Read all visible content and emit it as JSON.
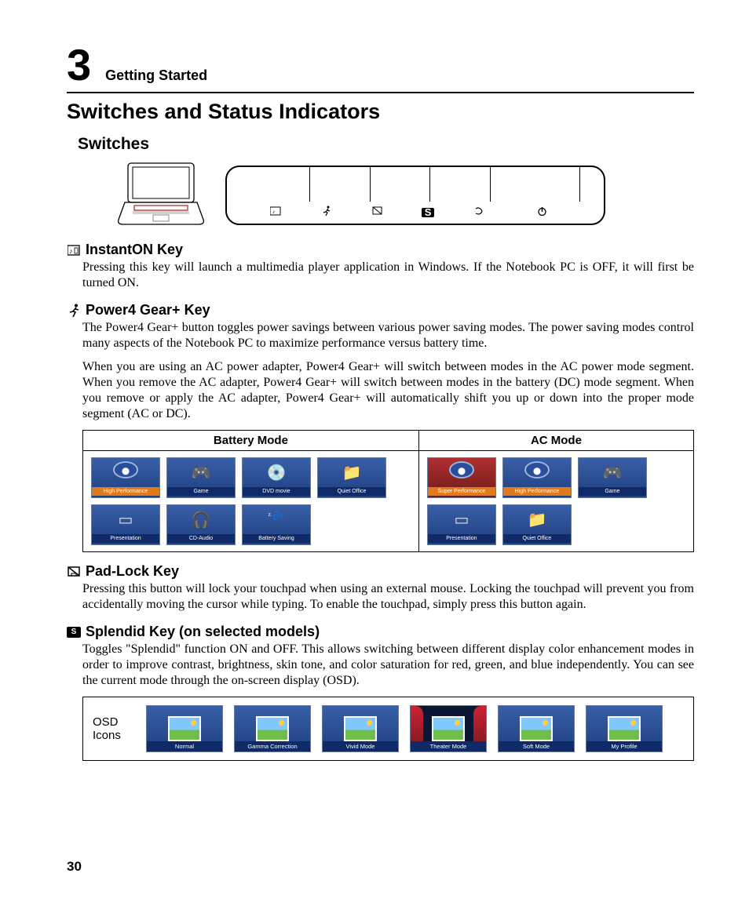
{
  "chapter": {
    "number": "3",
    "label": "Getting Started"
  },
  "section_title": "Switches and Status Indicators",
  "subsection_title": "Switches",
  "switch_icons": [
    "media",
    "runner",
    "padlock",
    "S",
    "bluetooth-swirl",
    "power"
  ],
  "keys": {
    "instanton": {
      "title": "InstantON Key",
      "body": "Pressing this key will launch a multimedia player application in Windows. If the Notebook PC is OFF, it will first be turned ON."
    },
    "power4": {
      "title": "Power4 Gear+ Key",
      "body1": "The Power4 Gear+ button toggles power savings between various power saving modes. The power saving modes control many aspects of the Notebook PC to maximize performance versus battery time.",
      "body2": "When you are using an AC power adapter, Power4 Gear+ will switch between modes in the AC power mode segment. When you remove the AC adapter, Power4 Gear+ will switch between modes in the battery (DC) mode segment. When you remove or apply the AC adapter, Power4 Gear+ will automatically shift you up or down into the proper mode segment (AC or DC)."
    },
    "padlock": {
      "title": "Pad-Lock Key",
      "body": "Pressing this button will lock your touchpad when using an external mouse. Locking the touchpad will prevent you from accidentally moving the cursor while typing. To enable the touchpad, simply press this button again."
    },
    "splendid": {
      "title": "Splendid Key (on selected models)",
      "body": "Toggles \"Splendid\" function ON and OFF. This allows switching between different display color enhancement modes in order to improve contrast, brightness, skin tone, and color saturation for red, green, and blue independently. You can see the current mode through the on-screen display (OSD)."
    }
  },
  "mode_table": {
    "headers": {
      "battery": "Battery Mode",
      "ac": "AC Mode"
    },
    "battery": [
      "High Performance",
      "Game",
      "DVD movie",
      "Quiet Office",
      "Presentation",
      "CD-Audio",
      "Battery Saving"
    ],
    "ac": [
      "Super Performance",
      "High Performance",
      "Game",
      "Presentation",
      "Quiet Office"
    ]
  },
  "osd": {
    "label": "OSD Icons",
    "modes": [
      "Normal",
      "Gamma Correction",
      "Vivid Mode",
      "Theater Mode",
      "Soft Mode",
      "My Profile"
    ]
  },
  "page_number": "30"
}
